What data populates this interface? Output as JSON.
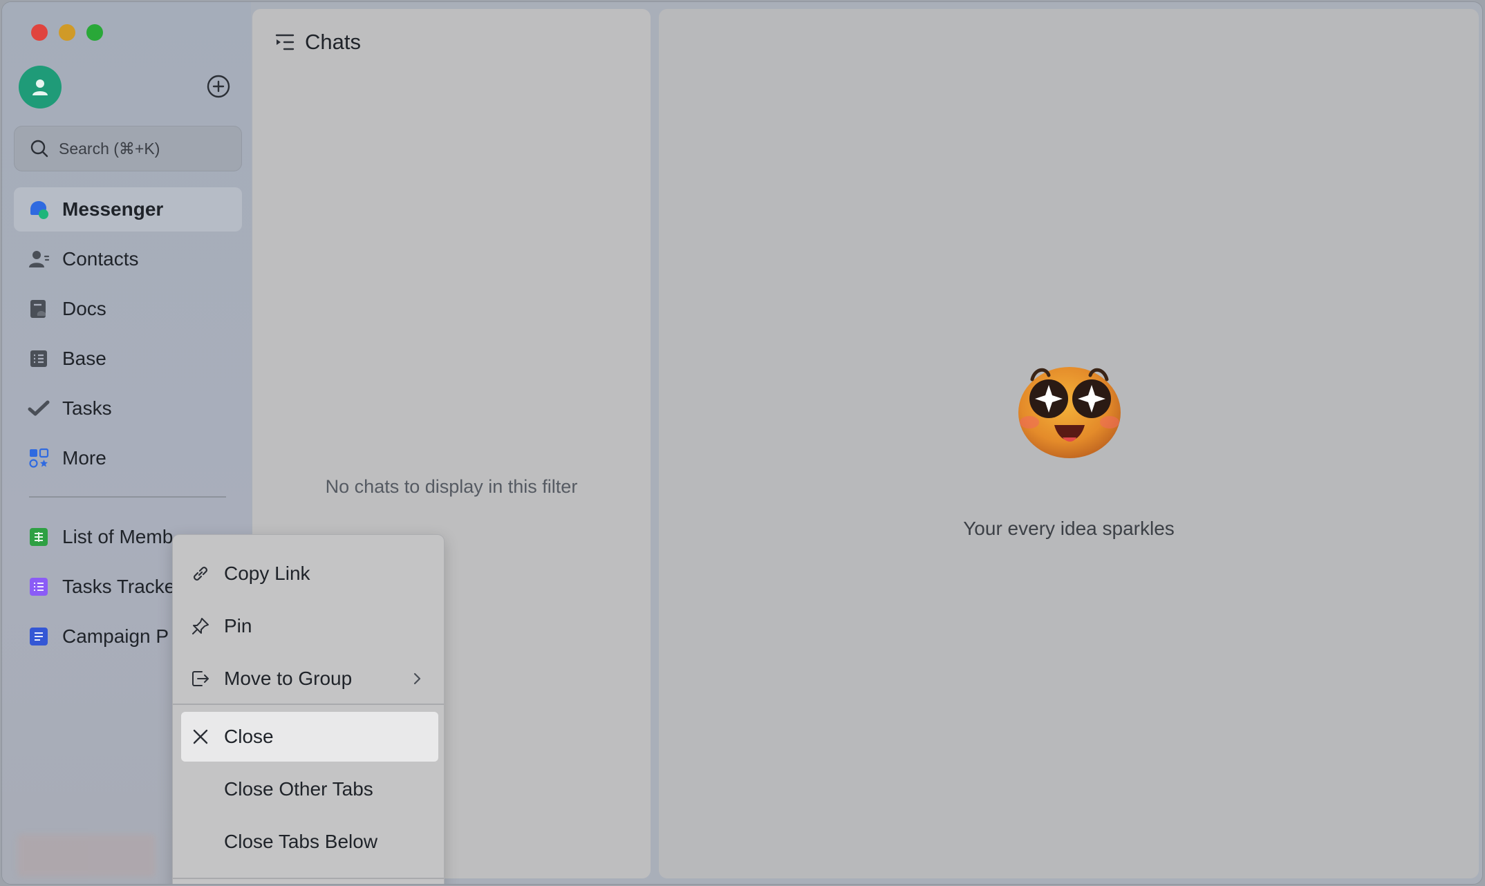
{
  "sidebar": {
    "search_placeholder": "Search (⌘+K)",
    "nav": [
      {
        "label": "Messenger",
        "icon": "messenger-icon"
      },
      {
        "label": "Contacts",
        "icon": "contacts-icon"
      },
      {
        "label": "Docs",
        "icon": "docs-icon"
      },
      {
        "label": "Base",
        "icon": "base-icon"
      },
      {
        "label": "Tasks",
        "icon": "tasks-icon"
      },
      {
        "label": "More",
        "icon": "more-apps-icon"
      }
    ],
    "pinned": [
      {
        "label": "List of Memb",
        "icon": "sheet-icon",
        "color": "#2ea043"
      },
      {
        "label": "Tasks Tracke",
        "icon": "list-icon",
        "color": "#8b5cf6"
      },
      {
        "label": "Campaign P",
        "icon": "doc-icon",
        "color": "#3457d5"
      }
    ]
  },
  "chats": {
    "title": "Chats",
    "empty_text": "No chats to display in this filter"
  },
  "main": {
    "tagline": "Your every idea sparkles"
  },
  "context_menu": {
    "items": [
      {
        "label": "Copy Link",
        "icon": "link-icon"
      },
      {
        "label": "Pin",
        "icon": "pin-icon"
      },
      {
        "label": "Move to Group",
        "icon": "move-to-group-icon"
      },
      {
        "label": "Close",
        "icon": "close-icon"
      },
      {
        "label": "Close Other Tabs"
      },
      {
        "label": "Close Tabs Below"
      }
    ]
  },
  "colors": {
    "accent_green": "#1f9b78",
    "messenger_blue": "#2f6ae0"
  }
}
